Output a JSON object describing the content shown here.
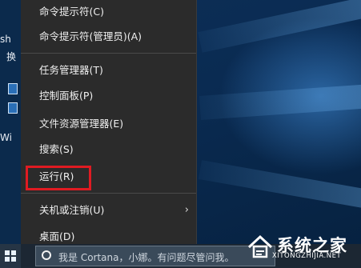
{
  "menu": {
    "items": [
      {
        "label": "命令提示符(C)"
      },
      {
        "label": "命令提示符(管理员)(A)"
      },
      {
        "label": "任务管理器(T)"
      },
      {
        "label": "控制面板(P)"
      },
      {
        "label": "文件资源管理器(E)"
      },
      {
        "label": "搜索(S)"
      },
      {
        "label": "运行(R)"
      },
      {
        "label": "关机或注销(U)"
      },
      {
        "label": "桌面(D)"
      }
    ],
    "highlighted_item": "运行(R)",
    "highlight_color": "#e01b22"
  },
  "desktop": {
    "partial_labels": [
      "sh",
      "换",
      "Wi"
    ]
  },
  "taskbar": {
    "search_text": "我是 Cortana，小娜。有问题尽管问我。"
  },
  "watermark": {
    "title": "系统之家",
    "url": "XITONGZHIJIA.NET"
  },
  "colors": {
    "menu_bg": "#2b2b2b",
    "menu_text": "#f0f0f0",
    "separator": "#4a4a4a",
    "taskbar_bg": "#1c2733",
    "desktop_bg": "#0a2b52"
  }
}
